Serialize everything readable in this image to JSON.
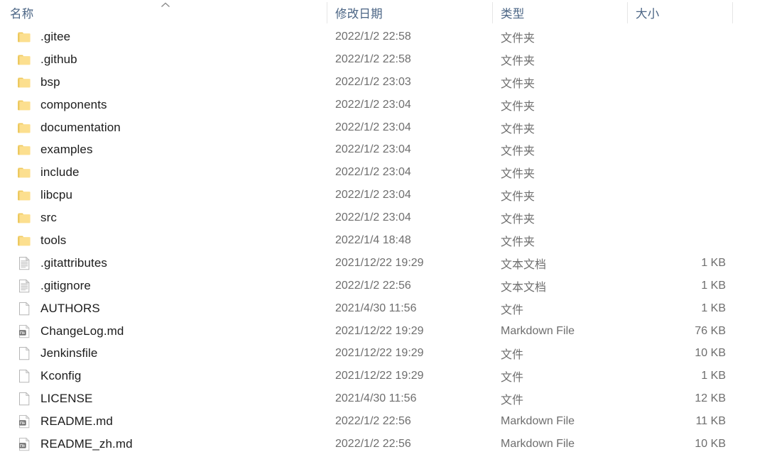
{
  "header": {
    "sort_indicator_icon": "chevron-up-icon",
    "sort_column": "name",
    "sort_direction": "ascending",
    "columns": [
      {
        "key": "name",
        "label": "名称"
      },
      {
        "key": "date",
        "label": "修改日期"
      },
      {
        "key": "type",
        "label": "类型"
      },
      {
        "key": "size",
        "label": "大小"
      }
    ]
  },
  "colors": {
    "header_text": "#4a6484",
    "name_text": "#1c1c1c",
    "meta_text": "#6e6e6e",
    "folder_icon": "#fcdd86",
    "folder_icon_dark": "#e8c65f",
    "separator": "#e6e6e6",
    "background": "#ffffff"
  },
  "rows": [
    {
      "icon": "folder-icon",
      "name": ".gitee",
      "date": "2022/1/2 22:58",
      "type": "文件夹",
      "size": ""
    },
    {
      "icon": "folder-icon",
      "name": ".github",
      "date": "2022/1/2 22:58",
      "type": "文件夹",
      "size": ""
    },
    {
      "icon": "folder-icon",
      "name": "bsp",
      "date": "2022/1/2 23:03",
      "type": "文件夹",
      "size": ""
    },
    {
      "icon": "folder-icon",
      "name": "components",
      "date": "2022/1/2 23:04",
      "type": "文件夹",
      "size": ""
    },
    {
      "icon": "folder-icon",
      "name": "documentation",
      "date": "2022/1/2 23:04",
      "type": "文件夹",
      "size": ""
    },
    {
      "icon": "folder-icon",
      "name": "examples",
      "date": "2022/1/2 23:04",
      "type": "文件夹",
      "size": ""
    },
    {
      "icon": "folder-icon",
      "name": "include",
      "date": "2022/1/2 23:04",
      "type": "文件夹",
      "size": ""
    },
    {
      "icon": "folder-icon",
      "name": "libcpu",
      "date": "2022/1/2 23:04",
      "type": "文件夹",
      "size": ""
    },
    {
      "icon": "folder-icon",
      "name": "src",
      "date": "2022/1/2 23:04",
      "type": "文件夹",
      "size": ""
    },
    {
      "icon": "folder-icon",
      "name": "tools",
      "date": "2022/1/4 18:48",
      "type": "文件夹",
      "size": ""
    },
    {
      "icon": "text-document-icon",
      "name": ".gitattributes",
      "date": "2021/12/22 19:29",
      "type": "文本文档",
      "size": "1 KB"
    },
    {
      "icon": "text-document-icon",
      "name": ".gitignore",
      "date": "2022/1/2 22:56",
      "type": "文本文档",
      "size": "1 KB"
    },
    {
      "icon": "blank-file-icon",
      "name": "AUTHORS",
      "date": "2021/4/30 11:56",
      "type": "文件",
      "size": "1 KB"
    },
    {
      "icon": "markdown-file-icon",
      "name": "ChangeLog.md",
      "date": "2021/12/22 19:29",
      "type": "Markdown File",
      "size": "76 KB"
    },
    {
      "icon": "blank-file-icon",
      "name": "Jenkinsfile",
      "date": "2021/12/22 19:29",
      "type": "文件",
      "size": "10 KB"
    },
    {
      "icon": "blank-file-icon",
      "name": "Kconfig",
      "date": "2021/12/22 19:29",
      "type": "文件",
      "size": "1 KB"
    },
    {
      "icon": "blank-file-icon",
      "name": "LICENSE",
      "date": "2021/4/30 11:56",
      "type": "文件",
      "size": "12 KB"
    },
    {
      "icon": "markdown-file-icon",
      "name": "README.md",
      "date": "2022/1/2 22:56",
      "type": "Markdown File",
      "size": "11 KB"
    },
    {
      "icon": "markdown-file-icon",
      "name": "README_zh.md",
      "date": "2022/1/2 22:56",
      "type": "Markdown File",
      "size": "10 KB"
    }
  ]
}
